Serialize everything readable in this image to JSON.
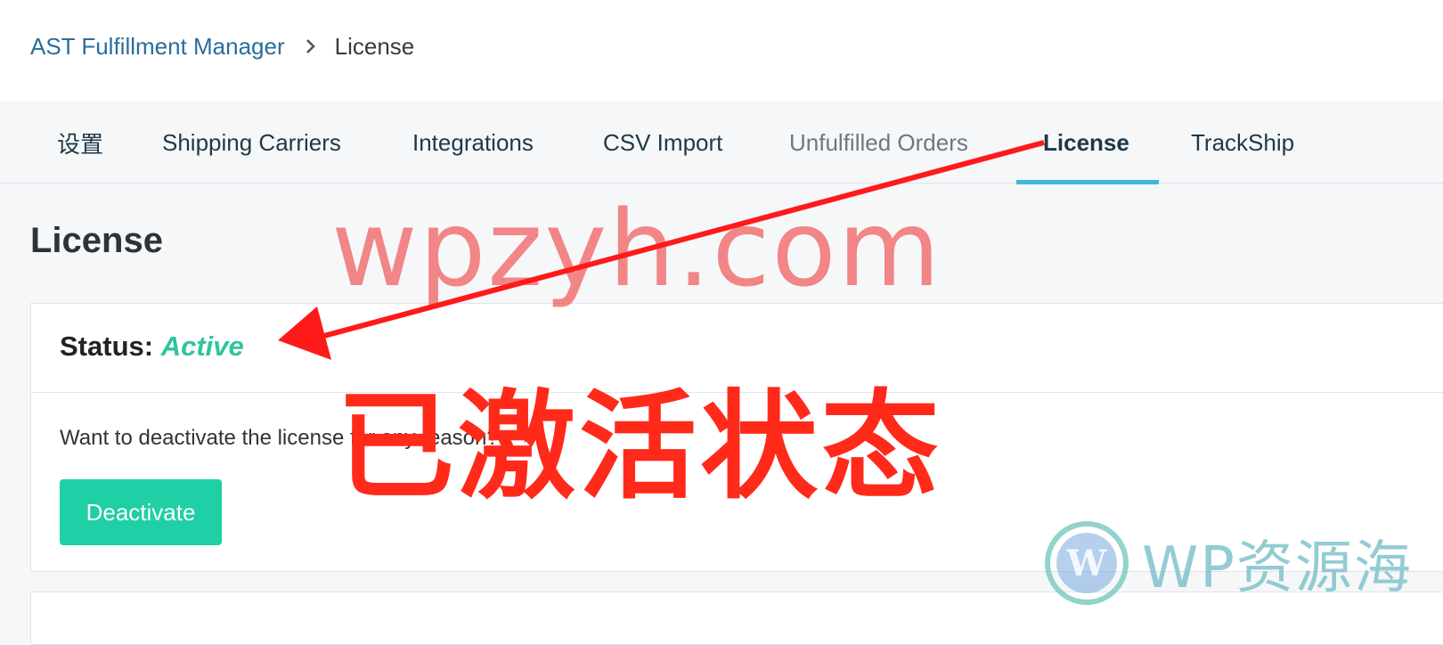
{
  "breadcrumb": {
    "parent": "AST Fulfillment Manager",
    "current": "License"
  },
  "tabs": [
    {
      "label": "设置"
    },
    {
      "label": "Shipping Carriers"
    },
    {
      "label": "Integrations"
    },
    {
      "label": "CSV Import"
    },
    {
      "label": "Unfulfilled Orders"
    },
    {
      "label": "License",
      "active": true
    },
    {
      "label": "TrackShip"
    }
  ],
  "page": {
    "title": "License"
  },
  "license_card": {
    "status_label": "Status:",
    "status_value": "Active",
    "deactivate_prompt": "Want to deactivate the license for any reason?",
    "deactivate_button": "Deactivate"
  },
  "overlay": {
    "watermark": "wpzyh.com",
    "annotation": "已激活状态",
    "logo_text": "WP资源海"
  },
  "colors": {
    "accent_tab": "#3fb9d8",
    "status_active": "#2ec4a0",
    "button": "#1fcfa6",
    "link": "#2b6d9b",
    "annotation": "#ff2a1a"
  }
}
